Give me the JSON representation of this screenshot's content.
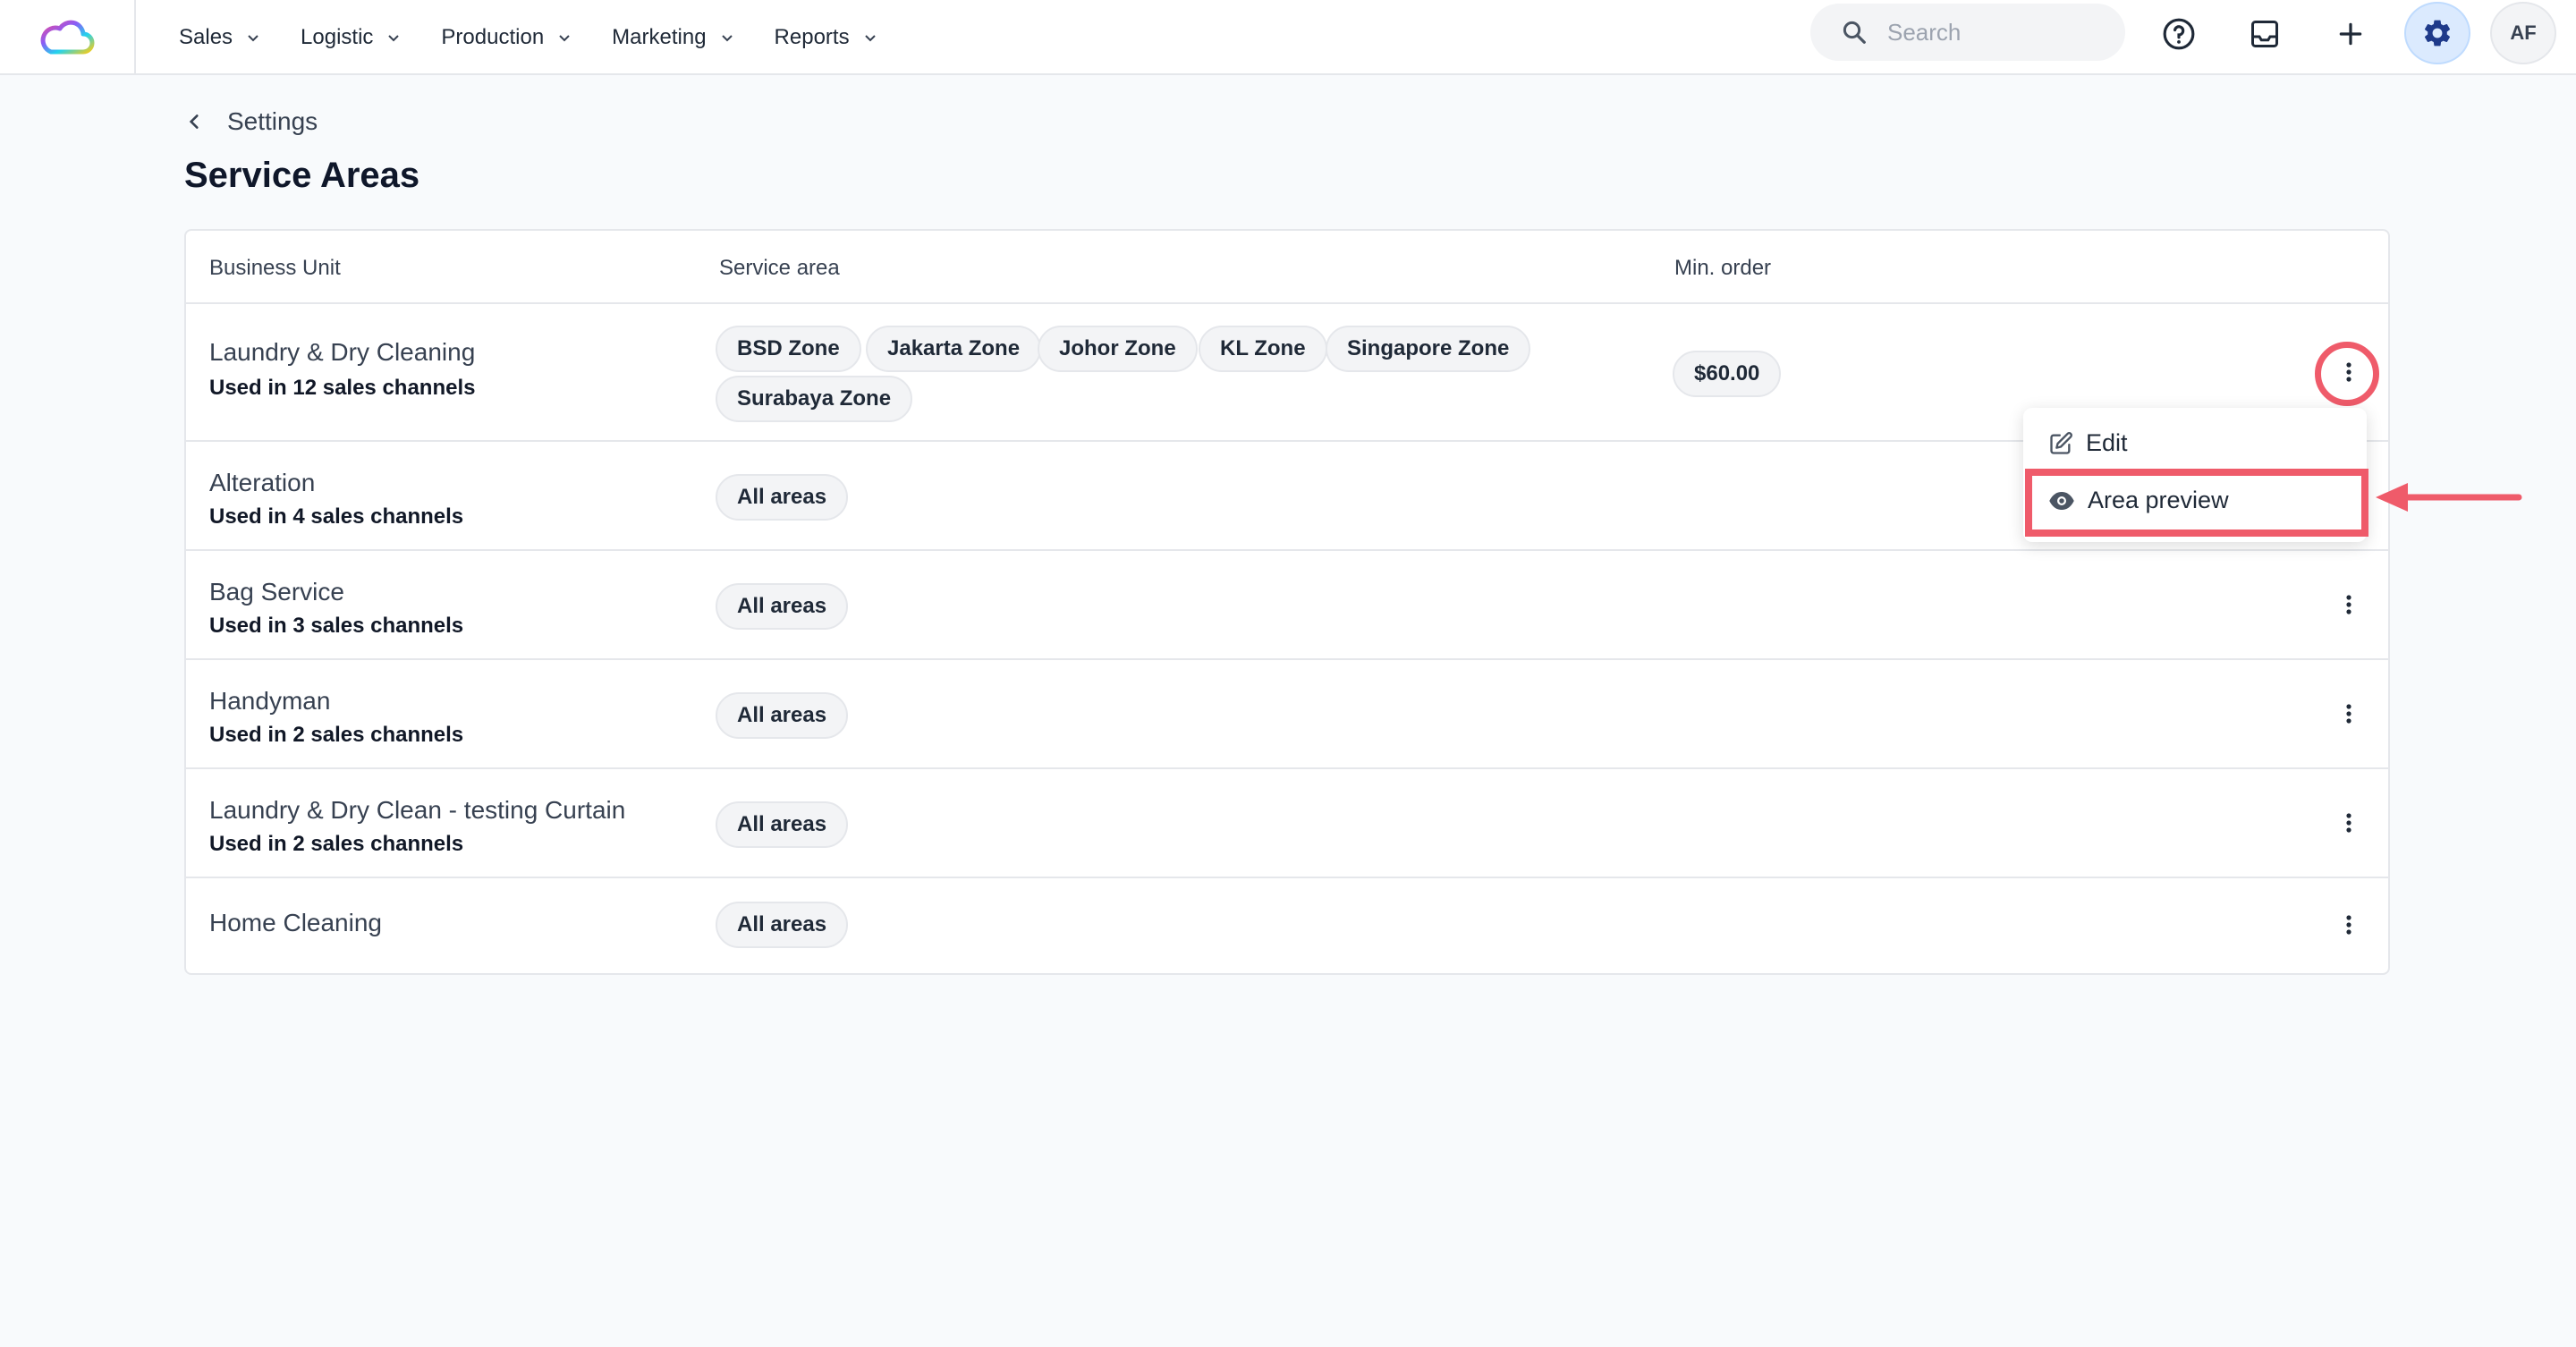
{
  "nav": {
    "items": [
      {
        "label": "Sales"
      },
      {
        "label": "Logistic"
      },
      {
        "label": "Production"
      },
      {
        "label": "Marketing"
      },
      {
        "label": "Reports"
      }
    ],
    "search_placeholder": "Search",
    "avatar_initials": "AF"
  },
  "breadcrumb": {
    "back_label": "Settings"
  },
  "page": {
    "title": "Service Areas"
  },
  "table": {
    "columns": [
      "Business Unit",
      "Service area",
      "Min. order"
    ],
    "rows": [
      {
        "name": "Laundry & Dry Cleaning",
        "channels": "Used in 12 sales channels",
        "areas": [
          "BSD Zone",
          "Jakarta Zone",
          "Johor Zone",
          "KL Zone",
          "Singapore Zone",
          "Surabaya Zone"
        ],
        "min_order": "$60.00"
      },
      {
        "name": "Alteration",
        "channels": "Used in 4 sales channels",
        "areas": [
          "All areas"
        ],
        "min_order": ""
      },
      {
        "name": "Bag Service",
        "channels": "Used in 3 sales channels",
        "areas": [
          "All areas"
        ],
        "min_order": ""
      },
      {
        "name": "Handyman",
        "channels": "Used in 2 sales channels",
        "areas": [
          "All areas"
        ],
        "min_order": ""
      },
      {
        "name": "Laundry & Dry Clean - testing Curtain",
        "channels": "Used in 2 sales channels",
        "areas": [
          "All areas"
        ],
        "min_order": ""
      },
      {
        "name": "Home Cleaning",
        "channels": "",
        "areas": [
          "All areas"
        ],
        "min_order": ""
      }
    ]
  },
  "row_menu": {
    "edit_label": "Edit",
    "preview_label": "Area preview"
  },
  "colors": {
    "accent": "#1e3a8a",
    "highlight": "#ef5b6a"
  },
  "icons": [
    "cloud-logo-icon",
    "chevron-down-icon",
    "search-icon",
    "help-circle-icon",
    "inbox-icon",
    "plus-icon",
    "gear-icon",
    "chevron-left-icon",
    "kebab-icon",
    "edit-icon",
    "eye-icon",
    "arrow-left-icon"
  ]
}
